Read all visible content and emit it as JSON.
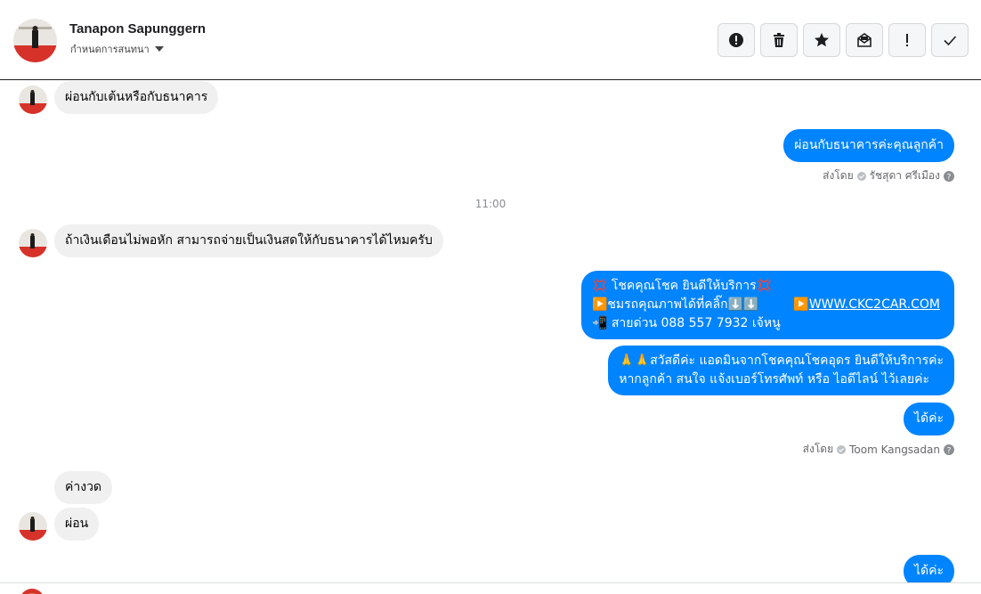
{
  "header": {
    "contact_name": "Tanapon Sapunggern",
    "conversation_label": "กำหนดการสนทนา",
    "actions": [
      {
        "name": "report-spam-icon",
        "label": "!"
      },
      {
        "name": "trash-icon",
        "label": "delete"
      },
      {
        "name": "star-icon",
        "label": "star"
      },
      {
        "name": "mark-unread-icon",
        "label": "unread"
      },
      {
        "name": "exclamation-icon",
        "label": "!"
      },
      {
        "name": "checkmark-icon",
        "label": "done"
      }
    ]
  },
  "messages": {
    "m1": "ผ่อนกับเต้นหรือกับธนาคาร",
    "m2": "ผ่อนกับธนาคารค่ะคุณลูกค้า",
    "m2_sentby_prefix": "ส่งโดย",
    "m2_sentby_name": "รัชสุดา ศรีเมือง",
    "time": "11:00",
    "m3": "ถ้าเงินเดือนไม่พอหัก สามารถจ่ายเป็นเงินสดให้กับธนาคารได้ไหมครับ",
    "m4_line1_emoji_a": "💢",
    "m4_line1_text": " โชคคุณโชค ยินดีให้บริการ",
    "m4_line1_emoji_b": "💢",
    "m4_line2_text": "▶️ชมรถคุณภาพได้ที่คลิ๊ก⬇️⬇️",
    "m4_line2_link_prefix": "▶️",
    "m4_line2_link": "WWW.CKC2CAR.COM",
    "m4_line3_text": "📲 สายด่วน 088 557 7932 เจ้หนู",
    "m5_line1": "🙏🙏สวัสดีค่ะ แอดมินจากโชคคุณโชคอุดร ยินดีให้บริการค่ะ",
    "m5_line2": "หากลูกค้า สนใจ แจ้งเบอร์โทรศัพท์ หรือ ไอดีไลน์  ไว้เลยค่ะ",
    "m6": "ได้ค่ะ",
    "m6_sentby_prefix": "ส่งโดย",
    "m6_sentby_name": "Toom Kangsadan",
    "m7": "ค่างวด",
    "m8": "ผ่อน",
    "m9": "ได้ค่ะ"
  },
  "colors": {
    "outgoing": "#0084ff",
    "incoming": "#f0f0f0",
    "avatar_red": "#d6322a"
  }
}
